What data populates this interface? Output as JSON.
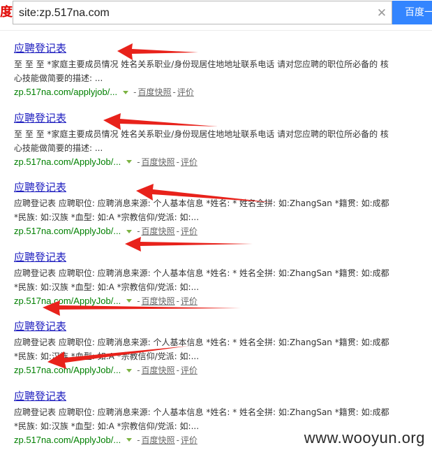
{
  "header": {
    "logo_fragment": "度",
    "search_value": "site:zp.517na.com",
    "clear_symbol": "✕",
    "search_button_label": "百度一下"
  },
  "results": [
    {
      "title": "应聘登记表",
      "abstract": "至 至 至 *家庭主要成员情况 姓名关系职业/身份现居住地地址联系电话 请对您应聘的职位所必备的 核心技能做简要的描述: ...",
      "url": "zp.517na.com/applyjob/...",
      "cache_label": "百度快照",
      "review_label": "评价",
      "separator": "-"
    },
    {
      "title": "应聘登记表",
      "abstract": "至 至 至 *家庭主要成员情况 姓名关系职业/身份现居住地地址联系电话 请对您应聘的职位所必备的 核心技能做简要的描述: ...",
      "url": "zp.517na.com/ApplyJob/...",
      "cache_label": "百度快照",
      "review_label": "评价",
      "separator": "-"
    },
    {
      "title": "应聘登记表",
      "abstract": "应聘登记表 应聘职位: 应聘消息来源: 个人基本信息 *姓名: * 姓名全拼: 如:ZhangSan *籍贯: 如:成都 *民族: 如:汉族 *血型: 如:A *宗教信仰/党派: 如:...",
      "url": "zp.517na.com/ApplyJob/...",
      "cache_label": "百度快照",
      "review_label": "评价",
      "separator": "-"
    },
    {
      "title": "应聘登记表",
      "abstract": "应聘登记表 应聘职位: 应聘消息来源: 个人基本信息 *姓名: * 姓名全拼: 如:ZhangSan *籍贯: 如:成都 *民族: 如:汉族 *血型: 如:A *宗教信仰/党派: 如:...",
      "url": "zp.517na.com/ApplyJob/...",
      "cache_label": "百度快照",
      "review_label": "评价",
      "separator": "-"
    },
    {
      "title": "应聘登记表",
      "abstract": "应聘登记表 应聘职位: 应聘消息来源: 个人基本信息 *姓名: * 姓名全拼: 如:ZhangSan *籍贯: 如:成都 *民族: 如:汉族 *血型: 如:A *宗教信仰/党派: 如:...",
      "url": "zp.517na.com/ApplyJob/...",
      "cache_label": "百度快照",
      "review_label": "评价",
      "separator": "-"
    },
    {
      "title": "应聘登记表",
      "abstract": "应聘登记表 应聘职位: 应聘消息来源: 个人基本信息 *姓名: * 姓名全拼: 如:ZhangSan *籍贯: 如:成都 *民族: 如:汉族 *血型: 如:A *宗教信仰/党派: 如:...",
      "url": "zp.517na.com/ApplyJob/...",
      "cache_label": "百度快照",
      "review_label": "评价",
      "separator": "-"
    }
  ],
  "annotation_color": "#e8221b",
  "watermark": "www.wooyun.org"
}
